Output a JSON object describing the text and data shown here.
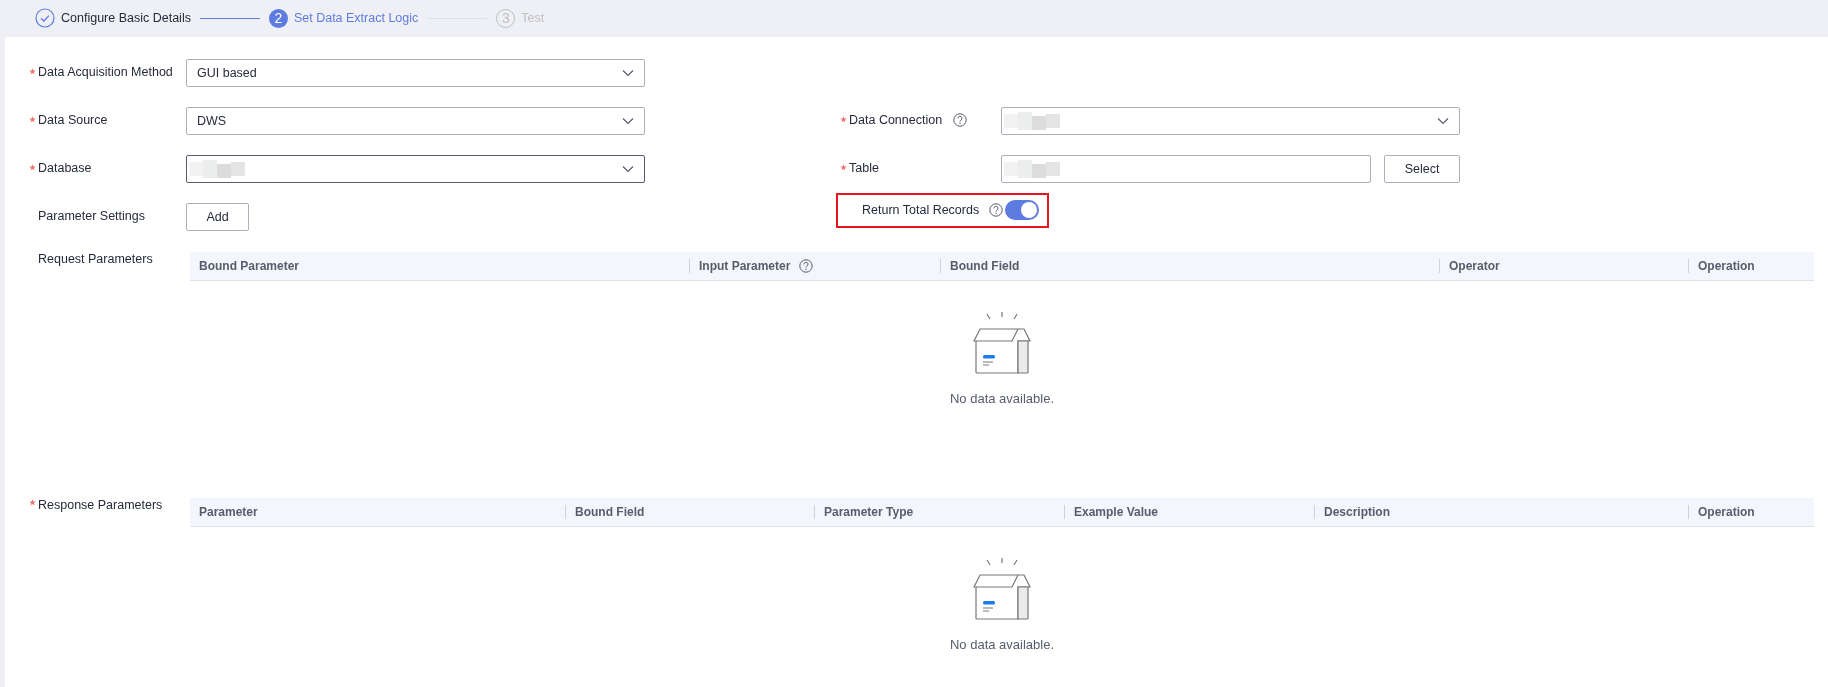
{
  "steps": [
    {
      "label": "Configure Basic Details",
      "done": true,
      "selected": false
    },
    {
      "label": "Set Data Extract Logic",
      "done": false,
      "selected": true,
      "number": "2"
    },
    {
      "label": "Test",
      "done": false,
      "selected": false,
      "number": "3"
    }
  ],
  "form_rows": [
    {
      "left": {
        "label": "Data Acquisition Method",
        "required": true,
        "kind": "select",
        "value": "GUI based",
        "focused": false
      }
    },
    {
      "left": {
        "label": "Data Source",
        "required": true,
        "kind": "select",
        "value": "DWS",
        "focused": false
      },
      "right": {
        "label": "Data Connection",
        "required": true,
        "help": true,
        "kind": "select",
        "redacted": true,
        "focused": false
      }
    },
    {
      "left": {
        "label": "Database",
        "required": true,
        "kind": "select",
        "redacted": true,
        "focused": true
      },
      "right": {
        "label": "Table",
        "required": true,
        "kind": "input",
        "redacted": true,
        "button": "Select",
        "focused": false
      }
    },
    {
      "left": {
        "label": "Parameter Settings",
        "required": false,
        "kind": "button",
        "button": "Add"
      },
      "right": {
        "label": "Return Total Records",
        "required": false,
        "help": true,
        "kind": "toggle",
        "on": true,
        "highlighted": true
      }
    }
  ],
  "tables": [
    {
      "label": "Request Parameters",
      "required": false,
      "columns": [
        {
          "label": "Bound Parameter",
          "help": false
        },
        {
          "label": "Input Parameter",
          "help": true
        },
        {
          "label": "Bound Field",
          "help": false
        },
        {
          "label": "Operator",
          "help": false
        },
        {
          "label": "Operation",
          "help": false
        }
      ],
      "empty_text": "No data available."
    },
    {
      "label": "Response Parameters",
      "required": true,
      "columns": [
        {
          "label": "Parameter",
          "help": false
        },
        {
          "label": "Bound Field",
          "help": false
        },
        {
          "label": "Parameter Type",
          "help": false
        },
        {
          "label": "Example Value",
          "help": false
        },
        {
          "label": "Description",
          "help": false
        },
        {
          "label": "Operation",
          "help": false
        }
      ],
      "empty_text": "No data available."
    }
  ]
}
